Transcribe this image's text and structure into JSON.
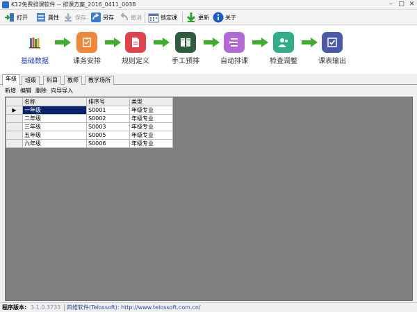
{
  "window": {
    "title": "K12免费排课软件 -- 排课方案_2016_0411_0038",
    "minimize": "–",
    "maximize": "□",
    "close": "✕"
  },
  "toolbar": {
    "open": "打开",
    "properties": "属性",
    "save": "保存",
    "save_as": "另存",
    "undo": "撤消",
    "lock": "锁定课",
    "update": "更新",
    "about": "关于"
  },
  "workflow": {
    "steps": [
      {
        "label": "基础数据",
        "icon": "books-icon",
        "color": "#ffffff",
        "active": true
      },
      {
        "label": "课务安排",
        "icon": "task-icon",
        "color": "#f0883a"
      },
      {
        "label": "规则定义",
        "icon": "document-icon",
        "color": "#e0424e"
      },
      {
        "label": "手工预排",
        "icon": "cards-icon",
        "color": "#2e5d3e"
      },
      {
        "label": "自动排课",
        "icon": "list-icon",
        "color": "#b26ad6"
      },
      {
        "label": "检查调整",
        "icon": "people-icon",
        "color": "#2fae88"
      },
      {
        "label": "课表输出",
        "icon": "check-icon",
        "color": "#4a5aa8"
      }
    ],
    "arrow_color": "#3fae2a"
  },
  "tabs": [
    "年级",
    "班级",
    "科目",
    "教师",
    "教学场所"
  ],
  "subtools": [
    "新增",
    "编辑",
    "删除",
    "向导导入"
  ],
  "table": {
    "columns": [
      "名称",
      "排序号",
      "类型"
    ],
    "rows": [
      [
        "一年级",
        "S0001",
        "年级专业"
      ],
      [
        "二年级",
        "S0002",
        "年级专业"
      ],
      [
        "三年级",
        "S0003",
        "年级专业"
      ],
      [
        "五年级",
        "S0005",
        "年级专业"
      ],
      [
        "六年级",
        "S0006",
        "年级专业"
      ]
    ],
    "current_row_marker": "▶"
  },
  "status": {
    "label": "程序版本:",
    "version": "3.1.0.3733",
    "company": "四维软件(Telossoft): http://www.telossoft.com.cn/"
  }
}
